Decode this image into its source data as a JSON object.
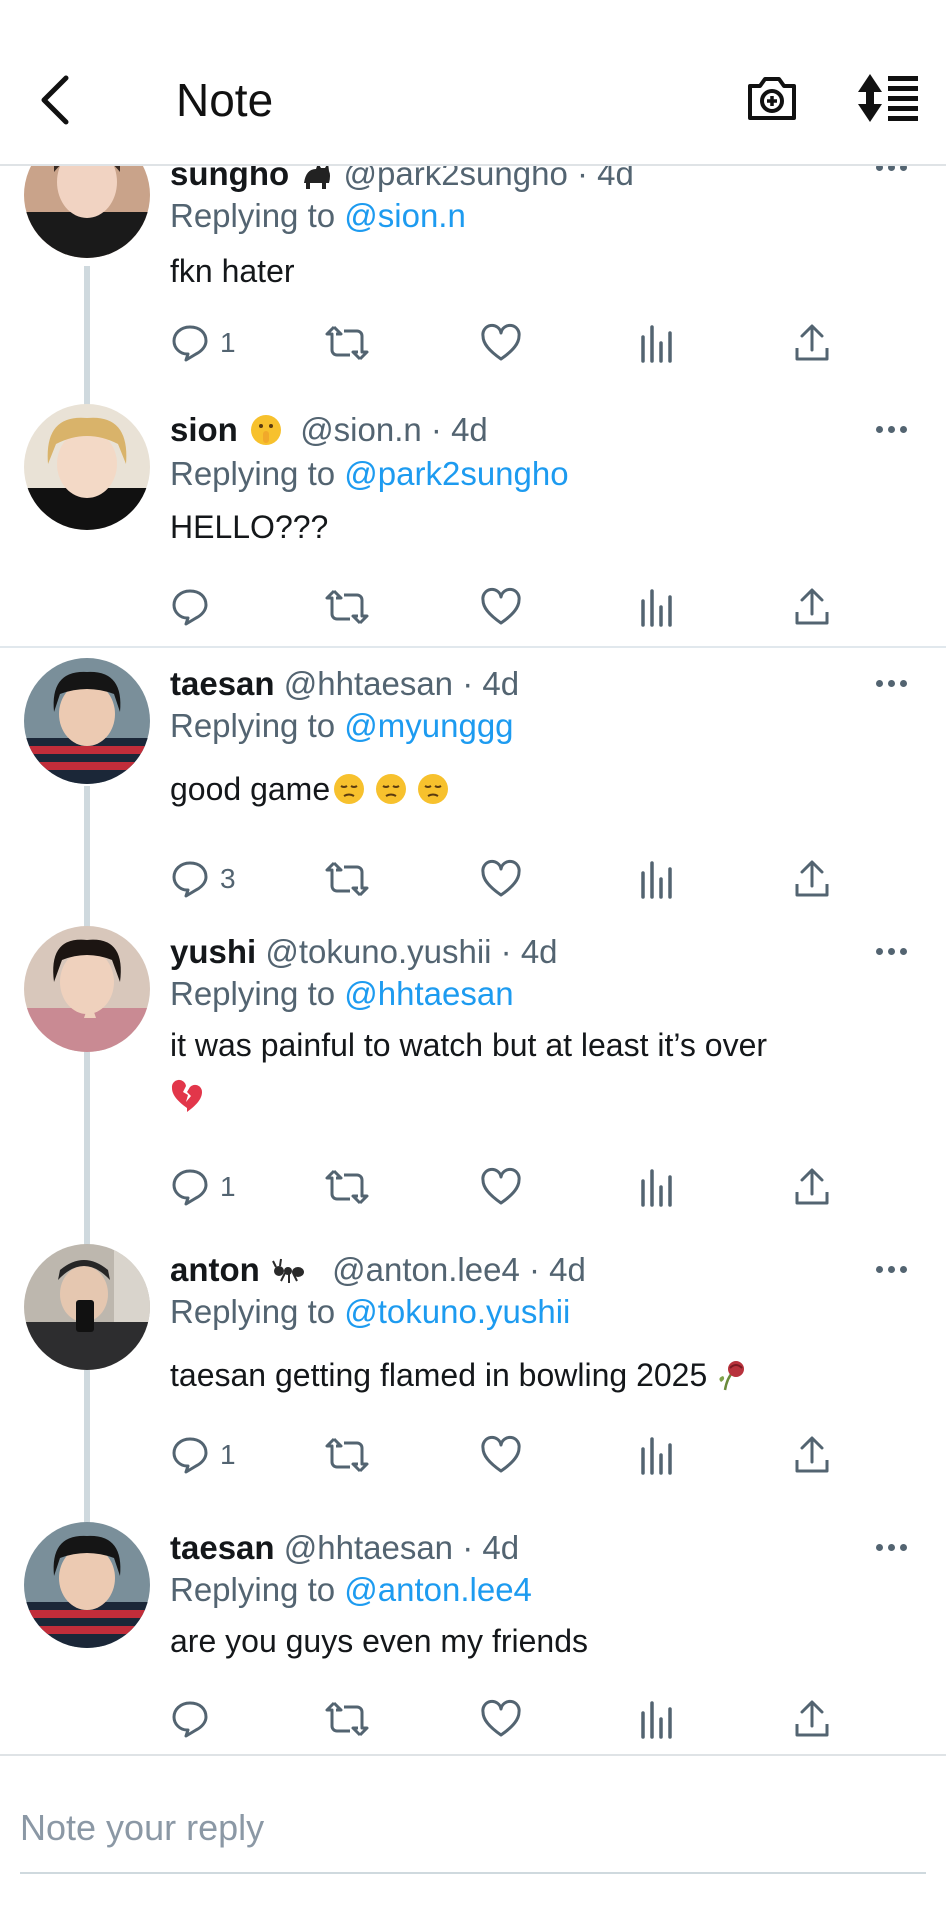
{
  "header": {
    "title": "Note"
  },
  "replies": [
    {
      "name": "sungho",
      "handle": "@park2sungho",
      "time": "4d",
      "replying_to": "@sion.n",
      "text": "fkn hater",
      "reply_count": "1",
      "avatar": "avatar-sungho"
    },
    {
      "name": "sion",
      "handle": "@sion.n",
      "time": "4d",
      "replying_to": "@park2sungho",
      "text": "HELLO???",
      "reply_count": "",
      "avatar": "avatar-sion"
    },
    {
      "name": "taesan",
      "handle": "@hhtaesan",
      "time": "4d",
      "replying_to": "@myunggg",
      "text": "good game",
      "reply_count": "3",
      "avatar": "avatar-taesan"
    },
    {
      "name": "yushi",
      "handle": "@tokuno.yushii",
      "time": "4d",
      "replying_to": "@hhtaesan",
      "text": "it was painful to watch but at least  it’s over",
      "reply_count": "1",
      "avatar": "avatar-yushi"
    },
    {
      "name": "anton",
      "handle": "@anton.lee4",
      "time": "4d",
      "replying_to": "@tokuno.yushii",
      "text": "taesan getting flamed in bowling 2025",
      "reply_count": "1",
      "avatar": "avatar-anton"
    },
    {
      "name": "taesan",
      "handle": "@hhtaesan",
      "time": "4d",
      "replying_to": "@anton.lee4",
      "text": "are you guys even my friends",
      "reply_count": "",
      "avatar": "avatar-taesan"
    }
  ],
  "labels": {
    "replying_prefix": "Replying to ",
    "dot": " · "
  },
  "composer": {
    "placeholder": "Note your reply"
  },
  "colors": {
    "link": "#1d9bf0",
    "muted": "#536471",
    "divider": "#e1e8ed",
    "thread_line": "#cfd9de"
  },
  "icons": [
    "back-chevron-icon",
    "camera-plus-icon",
    "sort-lines-icon",
    "reply-bubble-icon",
    "retweet-icon",
    "heart-icon",
    "analytics-icon",
    "share-icon",
    "more-dots-icon"
  ]
}
